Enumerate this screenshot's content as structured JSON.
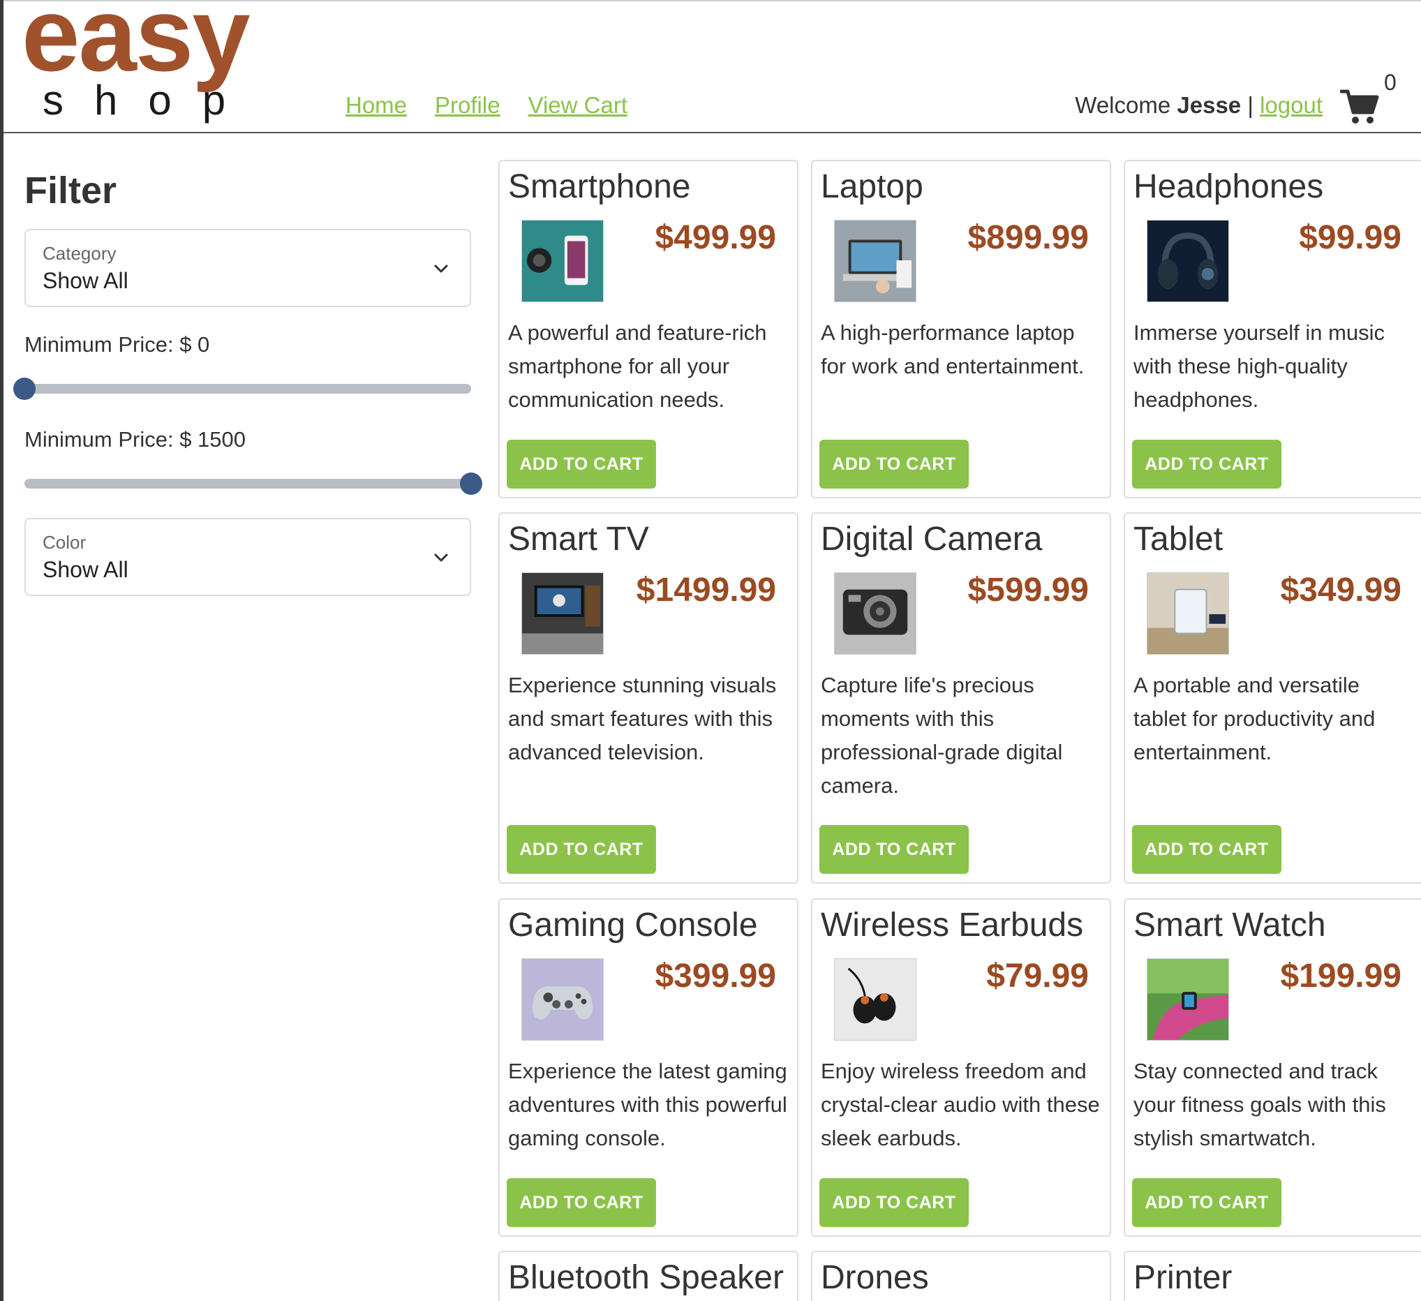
{
  "header": {
    "logo_top": "easy",
    "logo_bottom": "shop",
    "nav": [
      "Home",
      "Profile",
      "View Cart"
    ],
    "welcome_prefix": "Welcome",
    "username": "Jesse",
    "separator": "|",
    "logout_label": "logout",
    "cart_count": "0",
    "cart_icon": "shopping-cart-icon"
  },
  "sidebar": {
    "title": "Filter",
    "category": {
      "label": "Category",
      "value": "Show All"
    },
    "min_price": {
      "label": "Minimum Price: $ 0",
      "value": 0
    },
    "max_price": {
      "label": "Minimum Price: $ 1500",
      "value": 1500
    },
    "price_range": [
      0,
      1500
    ],
    "color": {
      "label": "Color",
      "value": "Show All"
    }
  },
  "colors": {
    "brand": "#a0522d",
    "accent": "#8bc34a",
    "price": "#9b4a22",
    "slider_thumb": "#3c5a86"
  },
  "button_label": "ADD TO CART",
  "products": [
    {
      "name": "Smartphone",
      "price": "$499.99",
      "description": "A powerful and feature-rich smartphone for all your communication needs."
    },
    {
      "name": "Laptop",
      "price": "$899.99",
      "description": "A high-performance laptop for work and entertainment."
    },
    {
      "name": "Headphones",
      "price": "$99.99",
      "description": "Immerse yourself in music with these high-quality headphones."
    },
    {
      "name": "Smart TV",
      "price": "$1499.99",
      "description": "Experience stunning visuals and smart features with this advanced television."
    },
    {
      "name": "Digital Camera",
      "price": "$599.99",
      "description": "Capture life's precious moments with this professional-grade digital camera."
    },
    {
      "name": "Tablet",
      "price": "$349.99",
      "description": "A portable and versatile tablet for productivity and entertainment."
    },
    {
      "name": "Gaming Console",
      "price": "$399.99",
      "description": "Experience the latest gaming adventures with this powerful gaming console."
    },
    {
      "name": "Wireless Earbuds",
      "price": "$79.99",
      "description": "Enjoy wireless freedom and crystal-clear audio with these sleek earbuds."
    },
    {
      "name": "Smart Watch",
      "price": "$199.99",
      "description": "Stay connected and track your fitness goals with this stylish smartwatch."
    },
    {
      "name": "Bluetooth Speaker"
    },
    {
      "name": "Drones"
    },
    {
      "name": "Printer"
    }
  ]
}
